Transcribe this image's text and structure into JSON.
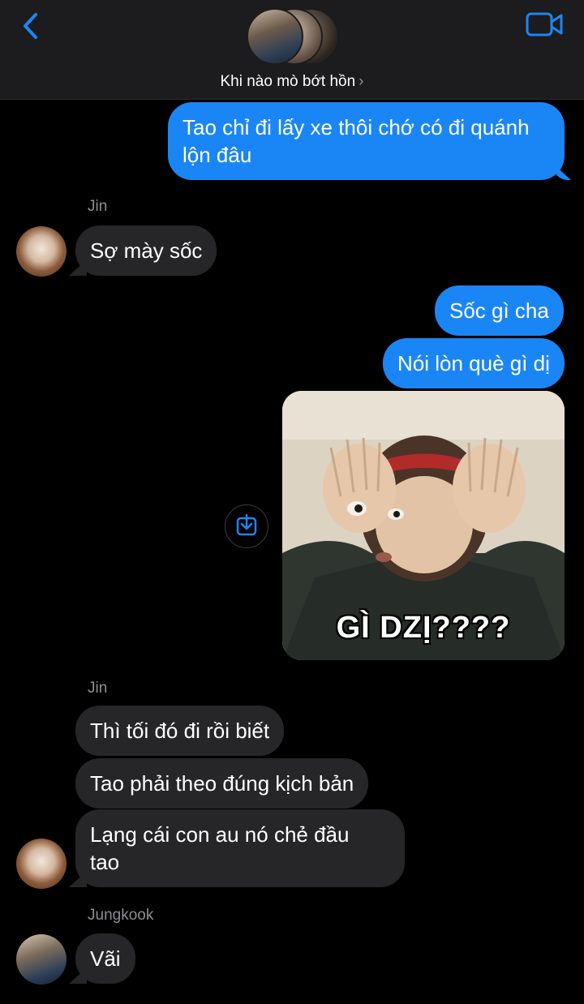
{
  "header": {
    "group_name": "Khi nào mò bớt hồn",
    "chevron": "›",
    "back_icon": "chevron-left-icon",
    "call_icon": "video-camera-icon",
    "accent": "#1a86f5"
  },
  "messages": [
    {
      "id": "m1",
      "dir": "out",
      "text_lines": [
        "Tao chỉ đi lấy xe thôi chớ có đi quánh",
        "lộn đâu"
      ]
    },
    {
      "id": "m2",
      "dir": "in",
      "sender": "Jin",
      "text": "Sợ mày sốc"
    },
    {
      "id": "m3",
      "dir": "out",
      "text": "Sốc gì cha"
    },
    {
      "id": "m4",
      "dir": "out",
      "text": "Nói lòn què gì dị"
    },
    {
      "id": "m5",
      "dir": "out",
      "type": "image",
      "caption": "GÌ DZỊ????",
      "action_icon": "save-download-icon"
    },
    {
      "id": "m6",
      "dir": "in",
      "sender": "Jin",
      "text": "Thì tối đó đi rồi biết"
    },
    {
      "id": "m7",
      "dir": "in",
      "text": "Tao phải theo đúng kịch bản"
    },
    {
      "id": "m8",
      "dir": "in",
      "text_lines": [
        "Lạng cái con au nó chẻ đầu",
        "tao"
      ]
    },
    {
      "id": "m9",
      "dir": "in",
      "sender": "Jungkook",
      "text": "Vãi"
    }
  ],
  "colors": {
    "sent_bubble": "#1a86f5",
    "recv_bubble": "#262628",
    "background": "#000000",
    "sender_label": "#8e8e93"
  }
}
